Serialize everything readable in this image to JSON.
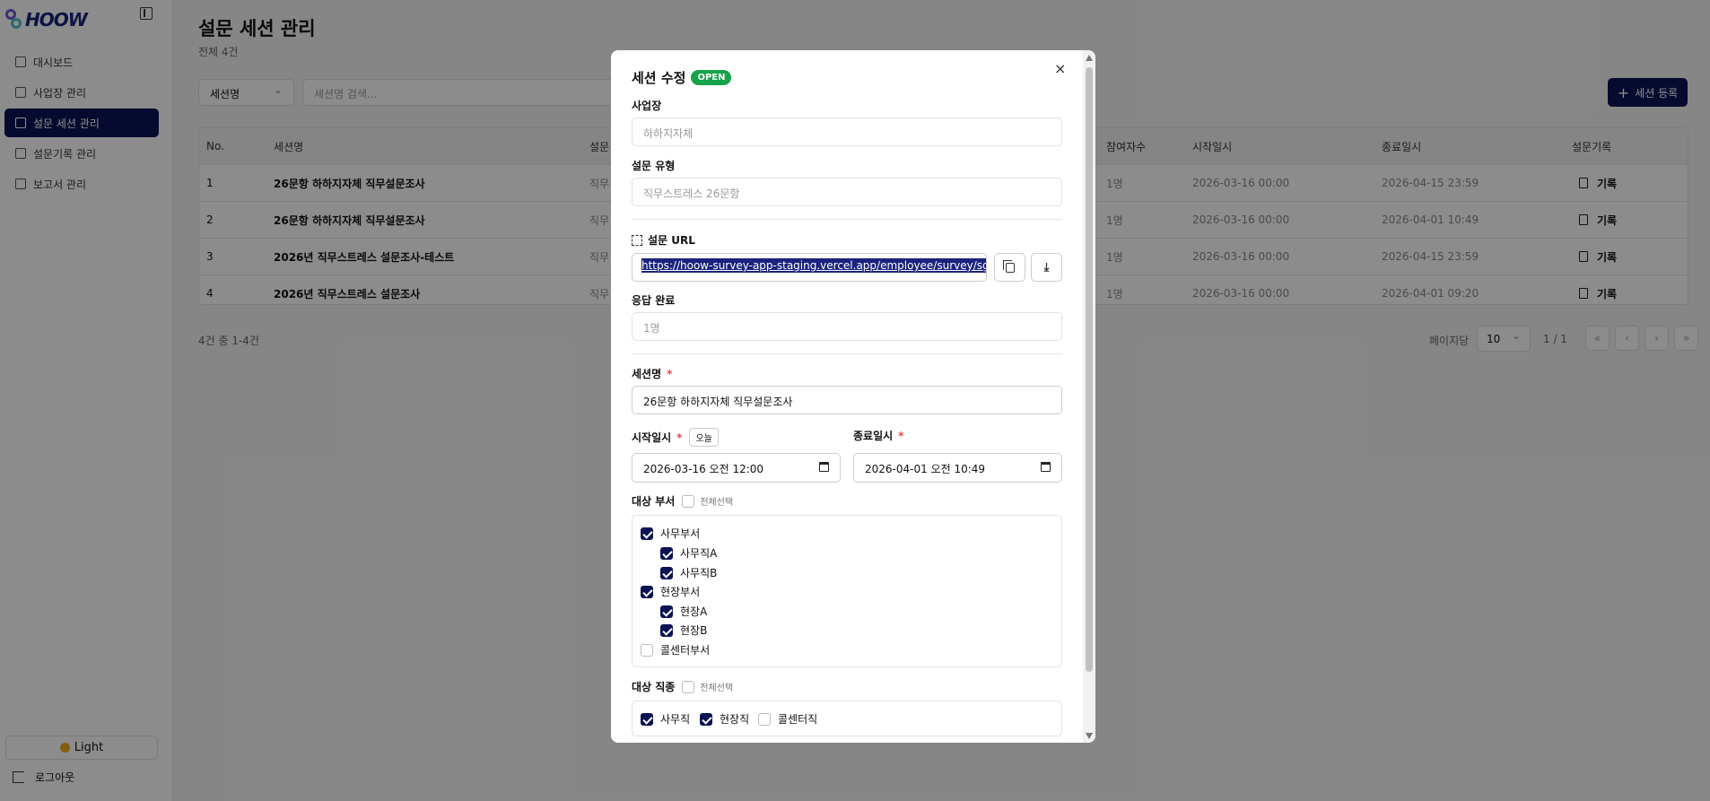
{
  "brand": {
    "logo_text": "HOOW"
  },
  "sidebar": {
    "items": [
      {
        "label": "대시보드"
      },
      {
        "label": "사업장 관리"
      },
      {
        "label": "설문 세션 관리"
      },
      {
        "label": "설문기록 관리"
      },
      {
        "label": "보고서 관리"
      }
    ],
    "theme_label": "Light",
    "logout_label": "로그아웃"
  },
  "page": {
    "title": "설문 세션 관리",
    "subtitle": "전체 4건",
    "filter_select": "세션명",
    "search_placeholder": "세션명 검색...",
    "add_button": "세션 등록"
  },
  "table": {
    "headers": [
      "No.",
      "세션명",
      "설문",
      "참여자수",
      "시작일시",
      "종료일시",
      "설문기록"
    ],
    "rows": [
      {
        "no": "1",
        "name": "26문항 하하지자체 직무설문조사",
        "type": "직무",
        "count": "1명",
        "start": "2026-03-16 00:00",
        "end": "2026-04-15 23:59",
        "record": "기록"
      },
      {
        "no": "2",
        "name": "26문항 하하지자체 직무설문조사",
        "type": "직무",
        "count": "1명",
        "start": "2026-03-16 00:00",
        "end": "2026-04-01 10:49",
        "record": "기록"
      },
      {
        "no": "3",
        "name": "2026년 직무스트레스 설문조사-테스트",
        "type": "직무",
        "count": "1명",
        "start": "2026-03-16 00:00",
        "end": "2026-04-15 23:59",
        "record": "기록"
      },
      {
        "no": "4",
        "name": "2026년 직무스트레스 설문조사",
        "type": "직무",
        "count": "1명",
        "start": "2026-03-16 00:00",
        "end": "2026-04-01 09:20",
        "record": "기록"
      }
    ],
    "count_text": "4건 중 1-4건"
  },
  "pagination": {
    "per_page_label": "페이지당",
    "per_page_value": "10",
    "page_info": "1 / 1",
    "first": "«",
    "prev": "‹",
    "next": "›",
    "last": "»"
  },
  "modal": {
    "title": "세션 수정",
    "status_badge": "OPEN",
    "close": "×",
    "site_label": "사업장",
    "site_value": "하하지자체",
    "type_label": "설문 유형",
    "type_value": "직무스트레스 26문항",
    "url_label": "설문 URL",
    "url_value": "https://hoow-survey-app-staging.vercel.app/employee/survey/sgP",
    "download_icon": "⤓",
    "response_label": "응답 완료",
    "response_value": "1명",
    "name_label": "세션명",
    "name_value": "26문항 하하지자체 직무설문조사",
    "required_mark": "*",
    "start_label": "시작일시",
    "today_button": "오늘",
    "start_value": "2026-03-16 오전 12:00",
    "end_label": "종료일시",
    "end_value": "2026-04-01 오전 10:49",
    "dept_label": "대상 부서",
    "select_all": "전체선택",
    "departments": [
      {
        "label": "사무부서",
        "checked": true,
        "level": 0
      },
      {
        "label": "사무직A",
        "checked": true,
        "level": 1
      },
      {
        "label": "사무직B",
        "checked": true,
        "level": 1
      },
      {
        "label": "현장부서",
        "checked": true,
        "level": 0
      },
      {
        "label": "현장A",
        "checked": true,
        "level": 1
      },
      {
        "label": "현장B",
        "checked": true,
        "level": 1
      },
      {
        "label": "콜센터부서",
        "checked": false,
        "level": 0
      }
    ],
    "job_label": "대상 직종",
    "jobs": [
      {
        "label": "사무직",
        "checked": true
      },
      {
        "label": "현장직",
        "checked": true
      },
      {
        "label": "콜센터직",
        "checked": false
      }
    ]
  },
  "colors": {
    "primary": "#0b1354",
    "badge_green": "#16a34a",
    "required_red": "#ef4444"
  }
}
